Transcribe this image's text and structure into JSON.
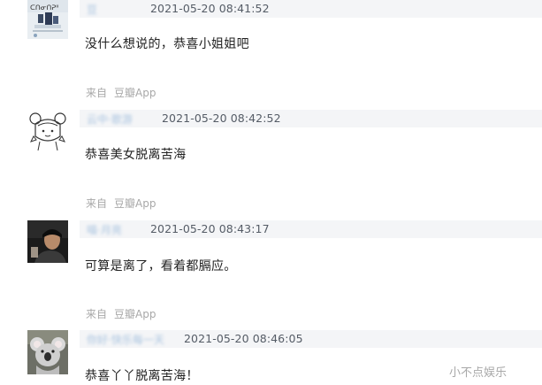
{
  "comments": [
    {
      "user": "豆",
      "time": "2021-05-20 08:41:52",
      "text": "没什么想说的，恭喜小姐姐吧",
      "source_prefix": "来自",
      "source_app": "豆瓣App",
      "avatar": "poster-avatar"
    },
    {
      "user": "云中·歌游",
      "time": "2021-05-20 08:42:52",
      "text": "恭喜美女脱离苦海",
      "source_prefix": "来自",
      "source_app": "豆瓣App",
      "avatar": "cartoon-girl-avatar"
    },
    {
      "user": "喵·月亮",
      "time": "2021-05-20 08:43:17",
      "text": "可算是离了，看着都膈应。",
      "source_prefix": "来自",
      "source_app": "豆瓣App",
      "avatar": "portrait-avatar"
    },
    {
      "user": "你好·快乐每一天",
      "time": "2021-05-20 08:46:05",
      "text": "恭喜丫丫脱离苦海！",
      "source_prefix": "",
      "source_app": "",
      "avatar": "koala-avatar"
    }
  ],
  "watermark": "小不点娱乐"
}
